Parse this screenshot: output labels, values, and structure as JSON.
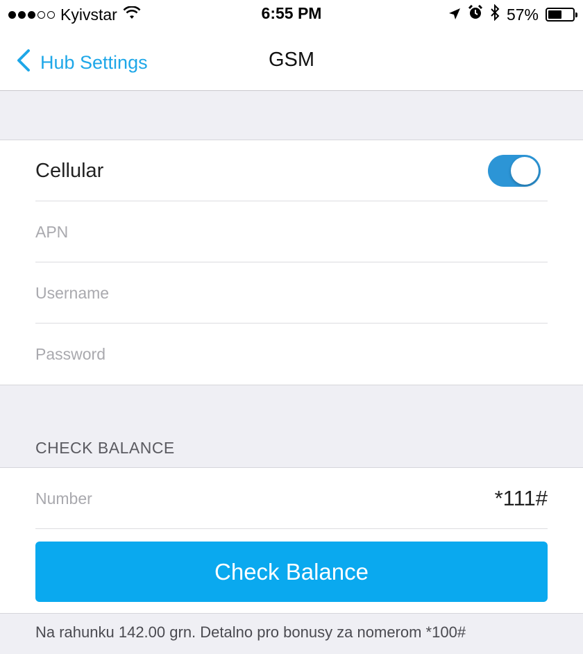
{
  "status_bar": {
    "carrier": "Kyivstar",
    "time": "6:55 PM",
    "battery_percent": "57%",
    "battery_level": 0.57,
    "signal_bars_filled": 3,
    "signal_bars_total": 5
  },
  "nav": {
    "back_label": "Hub Settings",
    "title": "GSM"
  },
  "cellular": {
    "label": "Cellular",
    "enabled": true,
    "apn_placeholder": "APN",
    "username_placeholder": "Username",
    "password_placeholder": "Password"
  },
  "check_balance": {
    "section_header": "CHECK BALANCE",
    "number_label": "Number",
    "number_value": "*111#",
    "button_label": "Check Balance",
    "result_text": "Na rahunku 142.00 grn. Detalno pro bonusy za nomerom *100#"
  },
  "colors": {
    "accent": "#1ea7e8",
    "button": "#0aa9ef",
    "toggle_on": "#2c95d6",
    "background": "#efeff4"
  }
}
